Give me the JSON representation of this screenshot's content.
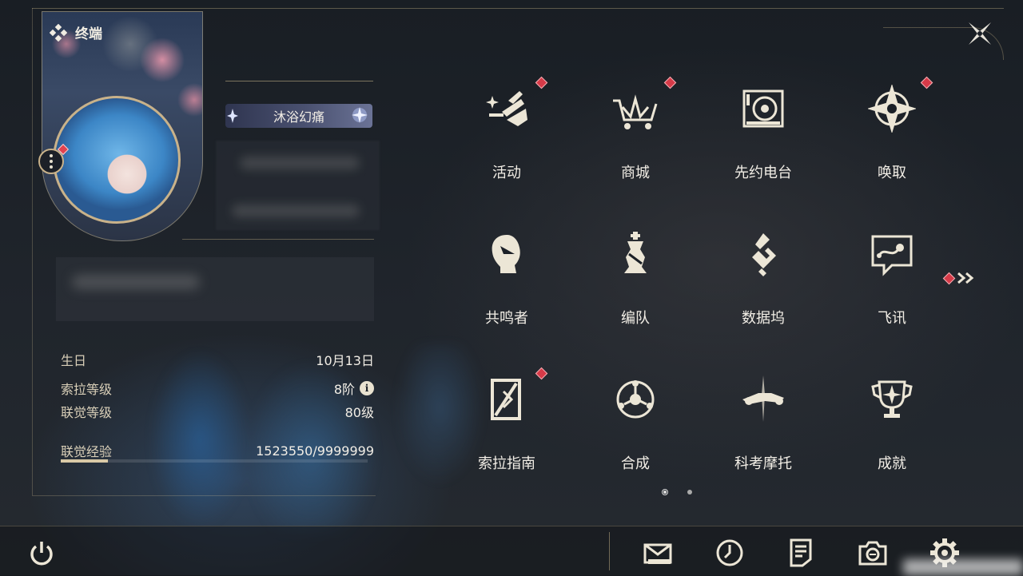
{
  "header": {
    "title": "终端"
  },
  "profile": {
    "name": "沐浴幻痛"
  },
  "stats": [
    {
      "label": "生日",
      "value": "10月13日"
    },
    {
      "label": "索拉等级",
      "value": "8阶"
    },
    {
      "label": "联觉等级",
      "value": "80级"
    },
    {
      "label": "联觉经验",
      "value": "1523550/9999999"
    }
  ],
  "xp_fraction": 0.152355,
  "menu": [
    {
      "label": "活动",
      "icon": "event-icon",
      "badge": true
    },
    {
      "label": "商城",
      "icon": "shop-cart-icon",
      "badge": true
    },
    {
      "label": "先约电台",
      "icon": "radio-icon",
      "badge": false
    },
    {
      "label": "唤取",
      "icon": "convene-icon",
      "badge": true
    },
    {
      "label": "共鸣者",
      "icon": "resonator-icon",
      "badge": false
    },
    {
      "label": "编队",
      "icon": "team-chess-icon",
      "badge": false
    },
    {
      "label": "数据坞",
      "icon": "data-bank-icon",
      "badge": false
    },
    {
      "label": "飞讯",
      "icon": "chat-icon",
      "badge": false
    },
    {
      "label": "索拉指南",
      "icon": "guide-icon",
      "badge": true
    },
    {
      "label": "合成",
      "icon": "synthesis-icon",
      "badge": false
    },
    {
      "label": "科考摩托",
      "icon": "motorbike-icon",
      "badge": false
    },
    {
      "label": "成就",
      "icon": "trophy-icon",
      "badge": false
    }
  ],
  "pager": {
    "current": 1,
    "total": 2
  },
  "bottom_bar": [
    "power-icon",
    "mail-icon",
    "clock-icon",
    "notes-icon",
    "camera-icon",
    "settings-gear-icon"
  ],
  "colors": {
    "accent": "#d9c9a6",
    "badge": "#d63a48",
    "text": "#f2eee6"
  }
}
